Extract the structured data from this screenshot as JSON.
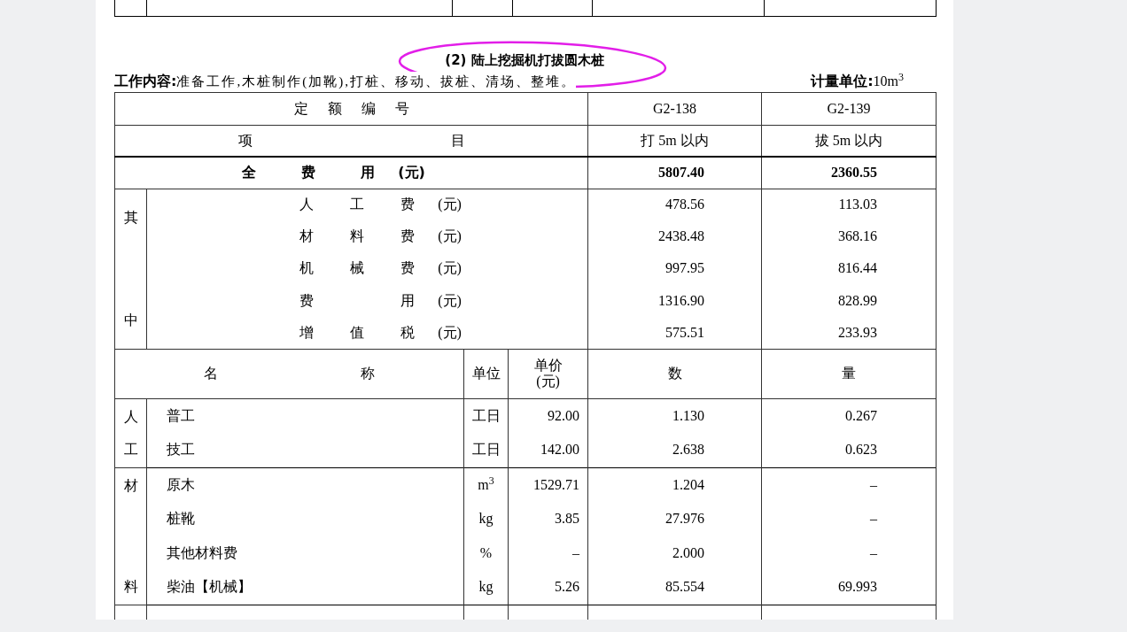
{
  "title": "(2) 陆上挖掘机打拔圆木桩",
  "work_content": {
    "label": "工作内容:",
    "text": "准备工作,木桩制作(加靴),打桩、移动、拔桩、清场、整堆。"
  },
  "unit_of_measure": {
    "label": "计量单位:",
    "text": "10m$^{3}$"
  },
  "quota_header": {
    "chars": [
      "定",
      "额",
      "编",
      "号"
    ],
    "codes": [
      "G2-138",
      "G2-139"
    ]
  },
  "item_header": {
    "chars": [
      "项",
      "目"
    ],
    "items": [
      "打 5m 以内",
      "拔 5m 以内"
    ]
  },
  "total": {
    "chars": [
      "全",
      "费",
      "用"
    ],
    "unit": "(元)",
    "values": [
      "5807.40",
      "2360.55"
    ]
  },
  "breakdown": {
    "category": [
      "其",
      "中"
    ],
    "rows": [
      {
        "chars": [
          "人",
          "工",
          "费"
        ],
        "unit": "(元)",
        "values": [
          "478.56",
          "113.03"
        ]
      },
      {
        "chars": [
          "材",
          "料",
          "费"
        ],
        "unit": "(元)",
        "values": [
          "2438.48",
          "368.16"
        ]
      },
      {
        "chars": [
          "机",
          "械",
          "费"
        ],
        "unit": "(元)",
        "values": [
          "997.95",
          "816.44"
        ]
      },
      {
        "chars": [
          "费",
          "用"
        ],
        "unit": "(元)",
        "values": [
          "1316.90",
          "828.99"
        ]
      },
      {
        "chars": [
          "增",
          "值",
          "税"
        ],
        "unit": "(元)",
        "values": [
          "575.51",
          "233.93"
        ]
      }
    ]
  },
  "resource_header": {
    "name_chars": [
      "名",
      "称"
    ],
    "unit": "单位",
    "price": [
      "单价",
      "(元)"
    ],
    "quantity_chars": [
      "数",
      "量"
    ]
  },
  "resource_groups": [
    {
      "category": [
        "人",
        "工"
      ],
      "rows": [
        {
          "name": "普工",
          "unit": "工日",
          "price": "92.00",
          "values": [
            "1.130",
            "0.267"
          ]
        },
        {
          "name": "技工",
          "unit": "工日",
          "price": "142.00",
          "values": [
            "2.638",
            "0.623"
          ]
        }
      ]
    },
    {
      "category": [
        "材",
        "料"
      ],
      "rows": [
        {
          "name": "原木",
          "unit": "m$^{3}$",
          "price": "1529.71",
          "values": [
            "1.204",
            "–"
          ]
        },
        {
          "name": "桩靴",
          "unit": "kg",
          "price": "3.85",
          "values": [
            "27.976",
            "–"
          ]
        },
        {
          "name": "其他材料费",
          "unit": "%",
          "price": "–",
          "values": [
            "2.000",
            "–"
          ]
        },
        {
          "name": "柴油【机械】",
          "unit": "kg",
          "price": "5.26",
          "values": [
            "85.554",
            "69.993"
          ]
        }
      ]
    }
  ]
}
